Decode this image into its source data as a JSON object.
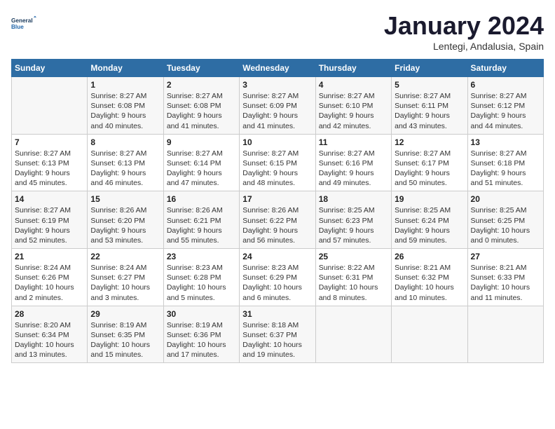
{
  "logo": {
    "line1": "General",
    "line2": "Blue"
  },
  "title": "January 2024",
  "subtitle": "Lentegi, Andalusia, Spain",
  "headers": [
    "Sunday",
    "Monday",
    "Tuesday",
    "Wednesday",
    "Thursday",
    "Friday",
    "Saturday"
  ],
  "weeks": [
    [
      {
        "day": "",
        "lines": []
      },
      {
        "day": "1",
        "lines": [
          "Sunrise: 8:27 AM",
          "Sunset: 6:08 PM",
          "Daylight: 9 hours",
          "and 40 minutes."
        ]
      },
      {
        "day": "2",
        "lines": [
          "Sunrise: 8:27 AM",
          "Sunset: 6:08 PM",
          "Daylight: 9 hours",
          "and 41 minutes."
        ]
      },
      {
        "day": "3",
        "lines": [
          "Sunrise: 8:27 AM",
          "Sunset: 6:09 PM",
          "Daylight: 9 hours",
          "and 41 minutes."
        ]
      },
      {
        "day": "4",
        "lines": [
          "Sunrise: 8:27 AM",
          "Sunset: 6:10 PM",
          "Daylight: 9 hours",
          "and 42 minutes."
        ]
      },
      {
        "day": "5",
        "lines": [
          "Sunrise: 8:27 AM",
          "Sunset: 6:11 PM",
          "Daylight: 9 hours",
          "and 43 minutes."
        ]
      },
      {
        "day": "6",
        "lines": [
          "Sunrise: 8:27 AM",
          "Sunset: 6:12 PM",
          "Daylight: 9 hours",
          "and 44 minutes."
        ]
      }
    ],
    [
      {
        "day": "7",
        "lines": [
          "Sunrise: 8:27 AM",
          "Sunset: 6:13 PM",
          "Daylight: 9 hours",
          "and 45 minutes."
        ]
      },
      {
        "day": "8",
        "lines": [
          "Sunrise: 8:27 AM",
          "Sunset: 6:13 PM",
          "Daylight: 9 hours",
          "and 46 minutes."
        ]
      },
      {
        "day": "9",
        "lines": [
          "Sunrise: 8:27 AM",
          "Sunset: 6:14 PM",
          "Daylight: 9 hours",
          "and 47 minutes."
        ]
      },
      {
        "day": "10",
        "lines": [
          "Sunrise: 8:27 AM",
          "Sunset: 6:15 PM",
          "Daylight: 9 hours",
          "and 48 minutes."
        ]
      },
      {
        "day": "11",
        "lines": [
          "Sunrise: 8:27 AM",
          "Sunset: 6:16 PM",
          "Daylight: 9 hours",
          "and 49 minutes."
        ]
      },
      {
        "day": "12",
        "lines": [
          "Sunrise: 8:27 AM",
          "Sunset: 6:17 PM",
          "Daylight: 9 hours",
          "and 50 minutes."
        ]
      },
      {
        "day": "13",
        "lines": [
          "Sunrise: 8:27 AM",
          "Sunset: 6:18 PM",
          "Daylight: 9 hours",
          "and 51 minutes."
        ]
      }
    ],
    [
      {
        "day": "14",
        "lines": [
          "Sunrise: 8:27 AM",
          "Sunset: 6:19 PM",
          "Daylight: 9 hours",
          "and 52 minutes."
        ]
      },
      {
        "day": "15",
        "lines": [
          "Sunrise: 8:26 AM",
          "Sunset: 6:20 PM",
          "Daylight: 9 hours",
          "and 53 minutes."
        ]
      },
      {
        "day": "16",
        "lines": [
          "Sunrise: 8:26 AM",
          "Sunset: 6:21 PM",
          "Daylight: 9 hours",
          "and 55 minutes."
        ]
      },
      {
        "day": "17",
        "lines": [
          "Sunrise: 8:26 AM",
          "Sunset: 6:22 PM",
          "Daylight: 9 hours",
          "and 56 minutes."
        ]
      },
      {
        "day": "18",
        "lines": [
          "Sunrise: 8:25 AM",
          "Sunset: 6:23 PM",
          "Daylight: 9 hours",
          "and 57 minutes."
        ]
      },
      {
        "day": "19",
        "lines": [
          "Sunrise: 8:25 AM",
          "Sunset: 6:24 PM",
          "Daylight: 9 hours",
          "and 59 minutes."
        ]
      },
      {
        "day": "20",
        "lines": [
          "Sunrise: 8:25 AM",
          "Sunset: 6:25 PM",
          "Daylight: 10 hours",
          "and 0 minutes."
        ]
      }
    ],
    [
      {
        "day": "21",
        "lines": [
          "Sunrise: 8:24 AM",
          "Sunset: 6:26 PM",
          "Daylight: 10 hours",
          "and 2 minutes."
        ]
      },
      {
        "day": "22",
        "lines": [
          "Sunrise: 8:24 AM",
          "Sunset: 6:27 PM",
          "Daylight: 10 hours",
          "and 3 minutes."
        ]
      },
      {
        "day": "23",
        "lines": [
          "Sunrise: 8:23 AM",
          "Sunset: 6:28 PM",
          "Daylight: 10 hours",
          "and 5 minutes."
        ]
      },
      {
        "day": "24",
        "lines": [
          "Sunrise: 8:23 AM",
          "Sunset: 6:29 PM",
          "Daylight: 10 hours",
          "and 6 minutes."
        ]
      },
      {
        "day": "25",
        "lines": [
          "Sunrise: 8:22 AM",
          "Sunset: 6:31 PM",
          "Daylight: 10 hours",
          "and 8 minutes."
        ]
      },
      {
        "day": "26",
        "lines": [
          "Sunrise: 8:21 AM",
          "Sunset: 6:32 PM",
          "Daylight: 10 hours",
          "and 10 minutes."
        ]
      },
      {
        "day": "27",
        "lines": [
          "Sunrise: 8:21 AM",
          "Sunset: 6:33 PM",
          "Daylight: 10 hours",
          "and 11 minutes."
        ]
      }
    ],
    [
      {
        "day": "28",
        "lines": [
          "Sunrise: 8:20 AM",
          "Sunset: 6:34 PM",
          "Daylight: 10 hours",
          "and 13 minutes."
        ]
      },
      {
        "day": "29",
        "lines": [
          "Sunrise: 8:19 AM",
          "Sunset: 6:35 PM",
          "Daylight: 10 hours",
          "and 15 minutes."
        ]
      },
      {
        "day": "30",
        "lines": [
          "Sunrise: 8:19 AM",
          "Sunset: 6:36 PM",
          "Daylight: 10 hours",
          "and 17 minutes."
        ]
      },
      {
        "day": "31",
        "lines": [
          "Sunrise: 8:18 AM",
          "Sunset: 6:37 PM",
          "Daylight: 10 hours",
          "and 19 minutes."
        ]
      },
      {
        "day": "",
        "lines": []
      },
      {
        "day": "",
        "lines": []
      },
      {
        "day": "",
        "lines": []
      }
    ]
  ]
}
